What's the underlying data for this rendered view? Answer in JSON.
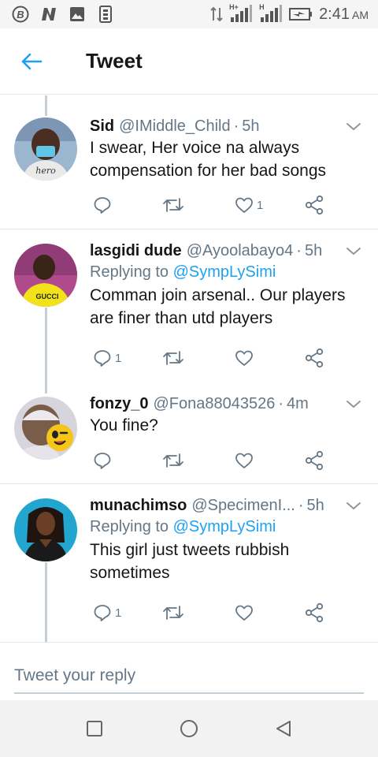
{
  "statusbar": {
    "time": "2:41",
    "ampm": "AM",
    "network_1": "H+",
    "network_2": "H"
  },
  "header": {
    "title": "Tweet"
  },
  "tweets": [
    {
      "name": "Sid",
      "handle": "@IMiddle_Child",
      "time": "5h",
      "replying_prefix": "",
      "replying_to": "",
      "text": "I swear, Her voice na always compensation for her bad songs",
      "reply_count": "",
      "retweet_count": "",
      "like_count": "1"
    },
    {
      "name": "lasgidi dude",
      "handle": "@Ayoolabayo4",
      "time": "5h",
      "replying_prefix": "Replying to",
      "replying_to": "@SympLySimi",
      "text": "Comman join arsenal.. Our players are finer than utd players",
      "reply_count": "1",
      "retweet_count": "",
      "like_count": ""
    },
    {
      "name": "fonzy_0",
      "handle": "@Fona88043526",
      "time": "4m",
      "replying_prefix": "",
      "replying_to": "",
      "text": "You fine?",
      "reply_count": "",
      "retweet_count": "",
      "like_count": ""
    },
    {
      "name": "munachimso",
      "handle": "@SpecimenI...",
      "time": "5h",
      "replying_prefix": "Replying to",
      "replying_to": "@SympLySimi",
      "text": "This girl just tweets rubbish sometimes",
      "reply_count": "1",
      "retweet_count": "",
      "like_count": ""
    }
  ],
  "reply_bar": {
    "placeholder": "Tweet your reply"
  },
  "colors": {
    "accent": "#1da1f2",
    "secondary_text": "#657786",
    "divider": "#e1e8ed"
  }
}
